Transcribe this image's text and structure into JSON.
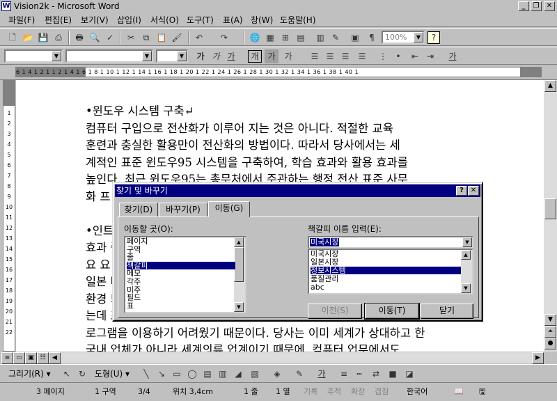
{
  "window": {
    "title": "Vision2k - Microsoft Word",
    "icon": "W"
  },
  "menu": [
    "파일(F)",
    "편집(E)",
    "보기(V)",
    "삽입(I)",
    "서식(O)",
    "도구(T)",
    "표(A)",
    "창(W)",
    "도움말(H)"
  ],
  "toolbar": {
    "zoom": "100%"
  },
  "format_toolbar": {
    "bold": "가",
    "italic": "가",
    "underline": "가",
    "boxed": "개",
    "shaded": "가",
    "charscale": "가",
    "font_color": "가"
  },
  "ruler": {
    "ticks": "6  1  4  1  2  1    1  2  1  4  1  6  1  8  1  10  1  12  1  14  1  16  1  18  1  20  1  22  1  24  1  26  1  28  1  30  1  32  1  34  1  36  1  38  1  40  1"
  },
  "vruler": [
    "1",
    "2",
    "3",
    "4",
    "5",
    "6",
    "7",
    "8",
    "9",
    "10",
    "11",
    "12",
    "13",
    "14",
    "15",
    "16",
    "17",
    "18",
    "19",
    "20",
    "21",
    "22"
  ],
  "document": {
    "lines": [
      "•윈도우 시스템 구축↵",
      "컴퓨터 구입으로 전산화가 이루어 지는 것은 아니다. 적절한 교육",
      "훈련과 충실한 활용만이 전산화의 방법이다. 따라서 당사에서는 세",
      "계적인 표준 윈도우95 시스템을 구축하여, 학습 효과와 활용 효과를",
      "높인다. 최근 윈도우95는 총무처에서 주관하는 행정 전산 표준 사무",
      "화 프",
      "",
      "•인트",
      "효과                                                                          중",
      "요 요                                                                          과",
      "일본                                                                          터",
      "환경                                                                          되",
      "는데                                                                          프",
      "로그램을 이용하기 어려웠기 때문이다. 당사는 이미 세계가 상대하고 한",
      "국내 업체가 아니라 세계의류 업계이기 때문에, 컴퓨터 업무에서도"
    ]
  },
  "dialog": {
    "title": "찾기 및 바꾸기",
    "help_btn": "?",
    "close_btn": "✕",
    "tabs": [
      "찾기(D)",
      "바꾸기(P)",
      "이동(G)"
    ],
    "active_tab": 2,
    "goto_label": "이동할 곳(O):",
    "goto_items": [
      "페이지",
      "구역",
      "줄",
      "책갈피",
      "메모",
      "각주",
      "미주",
      "필드",
      "표"
    ],
    "goto_selected": 3,
    "bookmark_label": "책갈피 이름 입력(E):",
    "bookmark_value": "미국시장",
    "bookmark_items": [
      "미국시장",
      "일본시장",
      "정보시스템",
      "품질관리",
      "abc"
    ],
    "bookmark_selected": 2,
    "buttons": {
      "prev": "이전(S)",
      "goto": "이동(T)",
      "close": "닫기"
    }
  },
  "drawbar": {
    "draw": "그리기(R) ▾",
    "autoshape": "도형(U) ▾",
    "font_color": "가"
  },
  "status": {
    "page": "3 페이지",
    "section": "1 구역",
    "page_of": "3/4",
    "position": "위치 3,4cm",
    "line": "1 줄",
    "column": "1 열",
    "rec": "기록",
    "trk": "추적",
    "ext": "확장",
    "ovr": "겹침",
    "language": "한국어"
  },
  "colors": {
    "titlebar_active": "#000080",
    "face": "#c0c0c0",
    "selection": "#000080"
  }
}
